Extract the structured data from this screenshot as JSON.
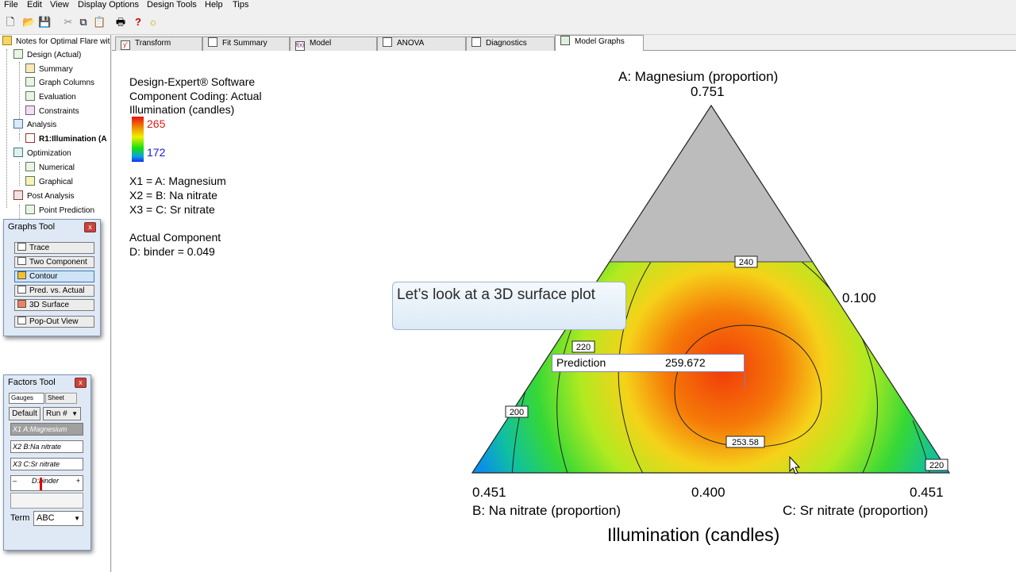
{
  "menu": [
    "File",
    "Edit",
    "View",
    "Display Options",
    "Design Tools",
    "Help",
    "Tips"
  ],
  "toolbar_icons": [
    "new-file-icon",
    "open-folder-icon",
    "save-icon",
    "cut-icon",
    "copy-icon",
    "paste-icon",
    "print-icon",
    "help-icon",
    "tip-icon"
  ],
  "tree": {
    "root": "Notes for Optimal Flare wit",
    "items": [
      {
        "label": "Design (Actual)",
        "level": 1
      },
      {
        "label": "Summary",
        "level": 2
      },
      {
        "label": "Graph Columns",
        "level": 2
      },
      {
        "label": "Evaluation",
        "level": 2
      },
      {
        "label": "Constraints",
        "level": 2
      },
      {
        "label": "Analysis",
        "level": 1
      },
      {
        "label": "R1:Illumination (A",
        "level": 2
      },
      {
        "label": "Optimization",
        "level": 1
      },
      {
        "label": "Numerical",
        "level": 2
      },
      {
        "label": "Graphical",
        "level": 2
      },
      {
        "label": "Post Analysis",
        "level": 1
      },
      {
        "label": "Point Prediction",
        "level": 2
      }
    ]
  },
  "graphs_tool": {
    "title": "Graphs Tool",
    "close": "x",
    "buttons": [
      "Trace",
      "Two Component",
      "Contour",
      "Pred. vs. Actual",
      "3D Surface"
    ],
    "popout": "Pop-Out View",
    "active": "Contour"
  },
  "factors_tool": {
    "title": "Factors Tool",
    "close": "x",
    "tab_gauges": "Gauges",
    "tab_sheet": "Sheet",
    "default_btn": "Default",
    "run_select": "Run #",
    "factors": [
      {
        "code": "X1",
        "name": "A:Magnesium"
      },
      {
        "code": "X2",
        "name": "B:Na nitrate"
      },
      {
        "code": "X3",
        "name": "C:Sr nitrate"
      }
    ],
    "slider_minus": "–",
    "slider_label": "D:binder",
    "slider_plus": "+",
    "term_label": "Term",
    "term_value": "ABC"
  },
  "tabs": [
    {
      "label": "Transform",
      "active": false
    },
    {
      "label": "Fit Summary",
      "active": false
    },
    {
      "label": "Model",
      "active": false
    },
    {
      "label": "ANOVA",
      "active": false
    },
    {
      "label": "Diagnostics",
      "active": false
    },
    {
      "label": "Model Graphs",
      "active": true
    }
  ],
  "info": {
    "line1": "Design-Expert® Software",
    "line2": "Component Coding: Actual",
    "line3": "Illumination (candles)",
    "scale_high": "265",
    "scale_low": "172",
    "x1": "X1 = A: Magnesium",
    "x2": "X2 = B: Na nitrate",
    "x3": "X3 = C: Sr nitrate",
    "actual_hdr": "Actual Component",
    "binder": "D: binder = 0.049"
  },
  "plot": {
    "top_axis": "A: Magnesium (proportion)",
    "top_value": "0.751",
    "right_value": "0.100",
    "bottom_left_value": "0.451",
    "bottom_mid_value": "0.400",
    "bottom_right_value": "0.451",
    "left_axis": "B: Na nitrate (proportion)",
    "right_axis": "C: Sr nitrate (proportion)",
    "response_title": "Illumination (candles)",
    "contour_labels": [
      "240",
      "220",
      "200",
      "253.58",
      "220"
    ],
    "prediction_label": "Prediction",
    "prediction_value": "259.672"
  },
  "colors": {
    "high": "#e01818",
    "low": "#1818e0",
    "mid_green": "#22cc22"
  },
  "callout": "Let’s look at a 3D surface plot"
}
